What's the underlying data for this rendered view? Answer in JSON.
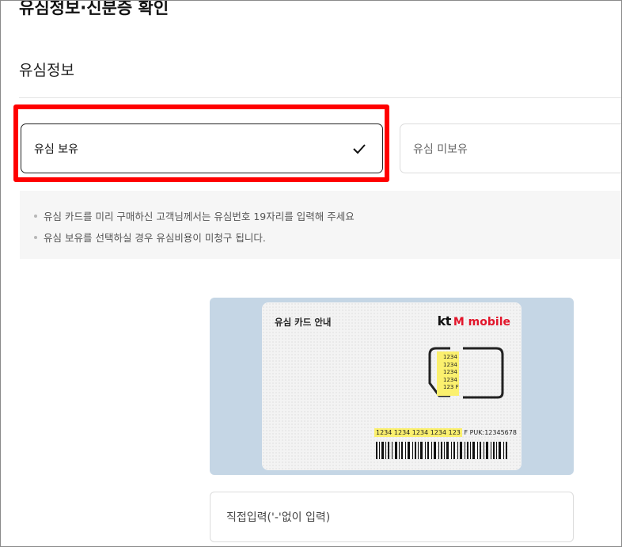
{
  "page": {
    "title": "유심정보·신분증 확인"
  },
  "section": {
    "title": "유심정보"
  },
  "options": {
    "have_sim": "유심 보유",
    "no_sim": "유심 미보유",
    "selected": "유심 보유"
  },
  "notice": [
    "유심 카드를 미리 구매하신 고객님께서는 유심번호 19자리를 입력해 주세요",
    "유심 보유를 선택하실 경우 유심비용이 미청구 됩니다."
  ],
  "sim_card": {
    "title": "유심 카드 안내",
    "brand_kt": "kt",
    "brand_rest": "M mobile",
    "chip_numbers": [
      "1234",
      "1234",
      "1234",
      "1234",
      "123 F"
    ],
    "iccid": "1234 1234 1234 1234 123",
    "iccid_suffix": "F  PUK:12345678"
  },
  "input": {
    "placeholder": "직접입력('-'없이 입력)"
  },
  "colors": {
    "highlight_border": "#ff0000",
    "brand_red": "#e2152a",
    "sim_background": "#c5d6e5",
    "number_highlight": "#fbf06e"
  }
}
